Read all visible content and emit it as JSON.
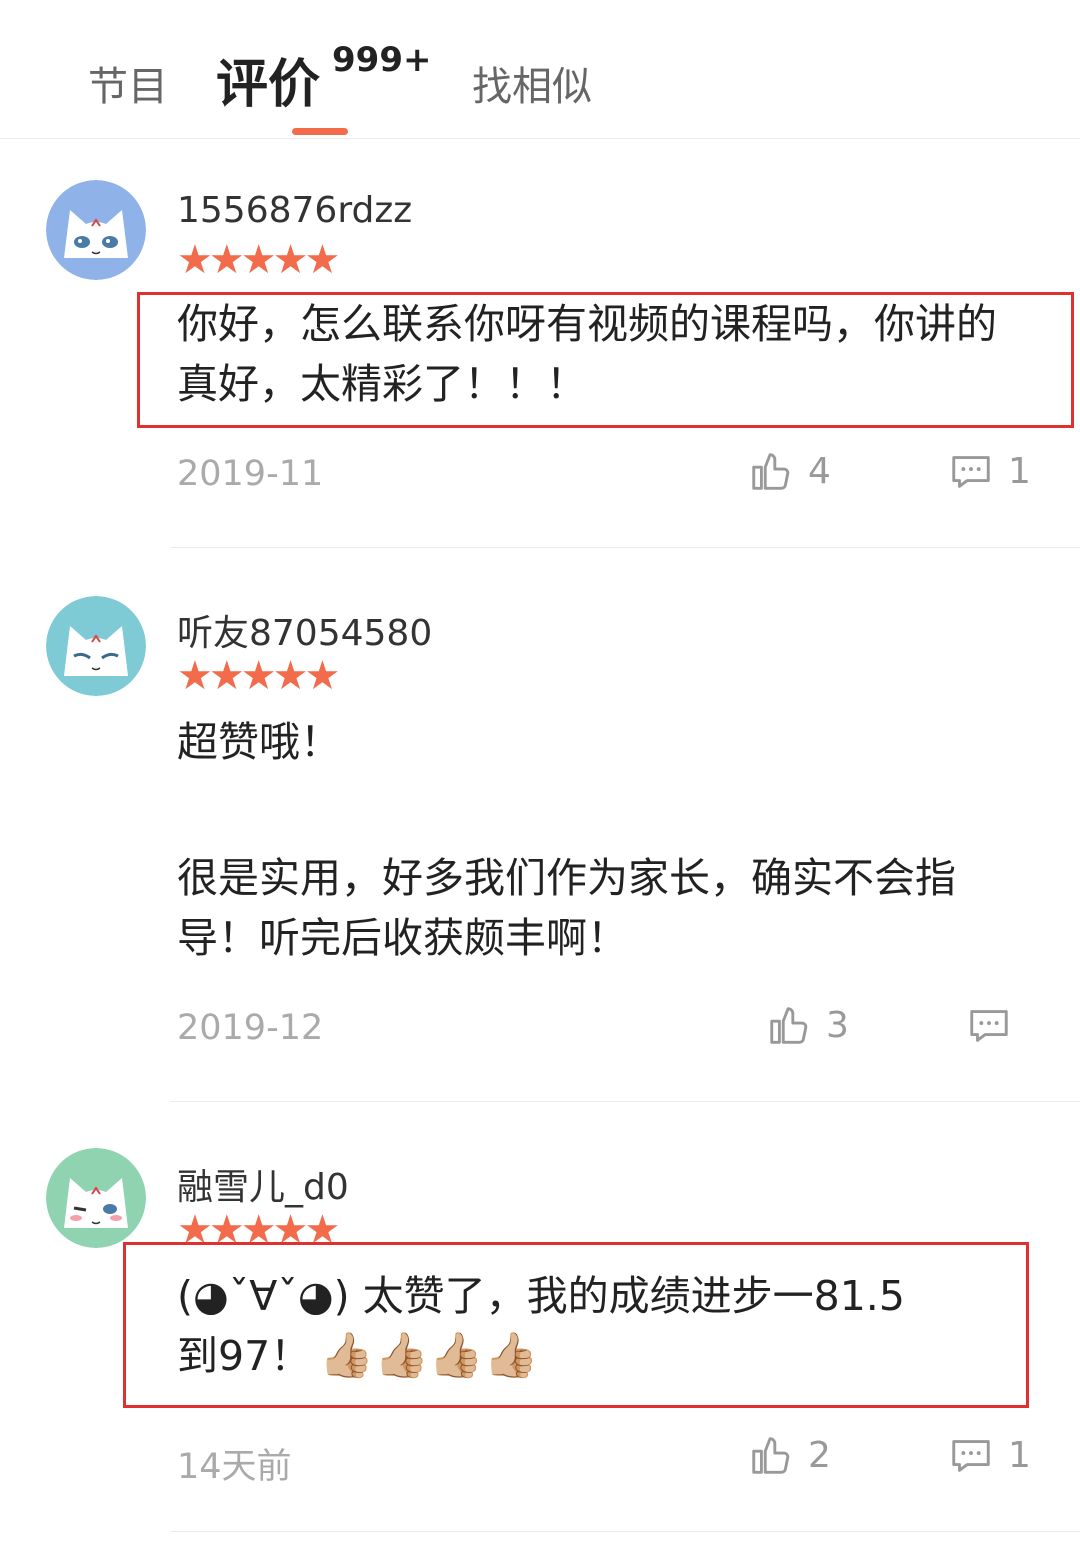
{
  "tabs": [
    {
      "label": "节目"
    },
    {
      "label": "评价",
      "count": "999+"
    },
    {
      "label": "找相似"
    }
  ],
  "reviews": [
    {
      "username": "1556876rdzz",
      "stars": "★★★★★",
      "body": "你好，怎么联系你呀有视频的课程吗，你讲的真好，太精彩了！！！",
      "date": "2019-11",
      "likes": "4",
      "replies": "1",
      "avatar_color": "#8fb3e8"
    },
    {
      "username": "听友87054580",
      "stars": "★★★★★",
      "body_line1": "超赞哦！",
      "body_line2": "很是实用，好多我们作为家长，确实不会指导！听完后收获颇丰啊！",
      "date": "2019-12",
      "likes": "3",
      "replies": "",
      "avatar_color": "#7ecbd6"
    },
    {
      "username": "融雪儿_d0",
      "stars": "★★★★★",
      "body": "(◕ˇ∀ˇ◕) 太赞了，我的成绩进步一81.5到97！",
      "thumbs": "👍🏼👍🏼👍🏼👍🏼",
      "date": "14天前",
      "likes": "2",
      "replies": "1",
      "avatar_color": "#8fd3b0"
    }
  ],
  "colors": {
    "accent": "#f26b4b",
    "highlight_border": "#e03030",
    "muted_text": "#aaaaaa"
  }
}
